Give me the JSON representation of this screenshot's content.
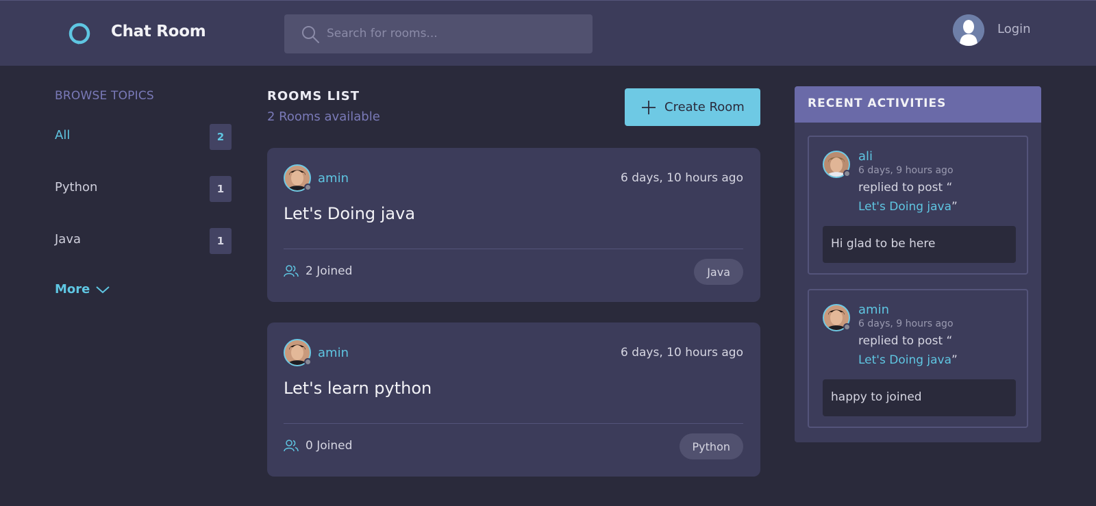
{
  "header": {
    "app_title": "Chat Room",
    "search_placeholder": "Search for rooms...",
    "login_label": "Login"
  },
  "sidebar": {
    "heading": "BROWSE TOPICS",
    "topics": [
      {
        "label": "All",
        "count": "2",
        "active": true
      },
      {
        "label": "Python",
        "count": "1",
        "active": false
      },
      {
        "label": "Java",
        "count": "1",
        "active": false
      }
    ],
    "more_label": "More"
  },
  "rooms": {
    "title": "ROOMS LIST",
    "available": "2 Rooms available",
    "create_label": "Create Room",
    "items": [
      {
        "host": "amin",
        "time": "6 days, 10 hours ago",
        "name": "Let's Doing java",
        "joined": "2 Joined",
        "topic": "Java"
      },
      {
        "host": "amin",
        "time": "6 days, 10 hours ago",
        "name": "Let's learn python",
        "joined": "0 Joined",
        "topic": "Python"
      }
    ]
  },
  "activities": {
    "title": "RECENT ACTIVITIES",
    "items": [
      {
        "user": "ali",
        "time": "6 days, 9 hours ago",
        "text": "replied to post “",
        "post": "Let's Doing java",
        "close_quote": "”",
        "message": "Hi glad to be here"
      },
      {
        "user": "amin",
        "time": "6 days, 9 hours ago",
        "text": "replied to post “",
        "post": "Let's Doing java",
        "close_quote": "”",
        "message": "happy to joined"
      }
    ]
  },
  "colors": {
    "accent": "#5fc6e2",
    "header_bg": "#3c3c5a",
    "page_bg": "#2a2a3b",
    "activities_header": "#6a6aa8"
  },
  "icons": [
    "logo-ring-icon",
    "search-icon",
    "user-avatar-icon",
    "chevron-down-icon",
    "plus-icon",
    "users-icon"
  ]
}
